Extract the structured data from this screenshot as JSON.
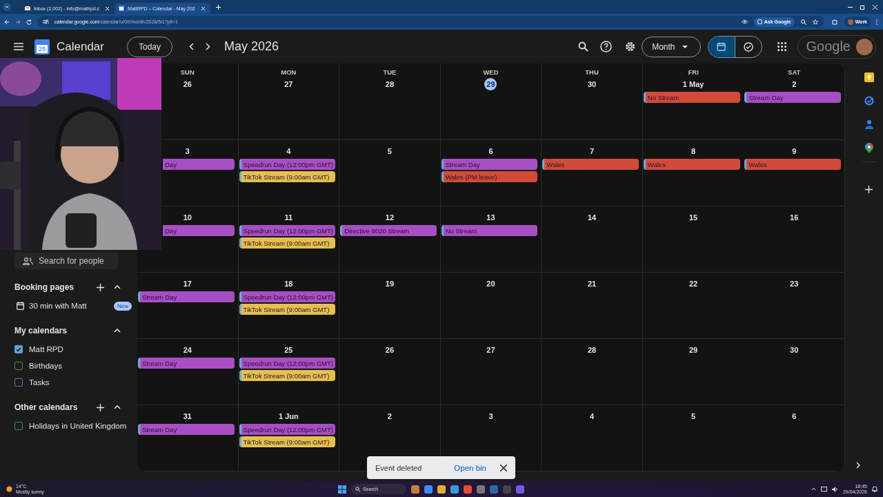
{
  "browser": {
    "tabs": [
      {
        "title": "Inbox (2,002) - info@mattrpd.c",
        "selected": false,
        "kind": "mail"
      },
      {
        "title": "MattRPD – Calendar - May 202",
        "selected": true,
        "kind": "calendar"
      }
    ],
    "url_host": "calendar.google.com",
    "url_path": "/calendar/u/0/r/month/2026/5/1?pli=1",
    "assistant": "Ask Google",
    "profile": "Work"
  },
  "header": {
    "logo_day": "29",
    "title": "Calendar",
    "today_button": "Today",
    "period": "May 2026",
    "view": "Month",
    "brand": "Google"
  },
  "sidebar": {
    "search_placeholder": "Search for people",
    "booking": {
      "title": "Booking pages",
      "items": [
        {
          "label": "30 min with Matt",
          "badge": "New"
        }
      ]
    },
    "my_calendars": {
      "title": "My calendars",
      "items": [
        {
          "label": "Matt RPD",
          "checked": true,
          "color": "#5ea3d9"
        },
        {
          "label": "Birthdays",
          "checked": false,
          "color": "#3c8a4c"
        },
        {
          "label": "Tasks",
          "checked": false,
          "color": "#5d6fbf"
        }
      ]
    },
    "other_calendars": {
      "title": "Other calendars",
      "items": [
        {
          "label": "Holidays in United Kingdom",
          "checked": false,
          "color": "#3c8a4c"
        }
      ]
    }
  },
  "calendar": {
    "weekdays": [
      "SUN",
      "MON",
      "TUE",
      "WED",
      "THU",
      "FRI",
      "SAT"
    ],
    "weeks": [
      [
        {
          "date": "26",
          "today": false
        },
        {
          "date": "27",
          "today": false
        },
        {
          "date": "28",
          "today": false
        },
        {
          "date": "29",
          "today": true
        },
        {
          "date": "30",
          "today": false
        },
        {
          "date": "1 May",
          "today": false,
          "events": [
            {
              "title": "No Stream",
              "color": "#d14b38"
            }
          ]
        },
        {
          "date": "2",
          "today": false,
          "events": [
            {
              "title": "Stream Day",
              "color": "#a84ec4"
            }
          ]
        }
      ],
      [
        {
          "date": "3",
          "today": false,
          "events": [
            {
              "title": "Day",
              "color": "#a84ec4"
            }
          ]
        },
        {
          "date": "4",
          "today": false,
          "events": [
            {
              "title": "Speedrun Day (12:00pm GMT)",
              "color": "#a84ec4"
            },
            {
              "title": "TikTok Stream (9:00am GMT)",
              "color": "#e5c050"
            }
          ]
        },
        {
          "date": "5",
          "today": false
        },
        {
          "date": "6",
          "today": false,
          "events": [
            {
              "title": "Stream Day",
              "color": "#a84ec4"
            },
            {
              "title": "Wales (PM leave)",
              "color": "#d14b38"
            }
          ]
        },
        {
          "date": "7",
          "today": false,
          "events": [
            {
              "title": "Wales",
              "color": "#d14b38"
            }
          ]
        },
        {
          "date": "8",
          "today": false,
          "events": [
            {
              "title": "Wales",
              "color": "#d14b38"
            }
          ]
        },
        {
          "date": "9",
          "today": false,
          "events": [
            {
              "title": "Wales",
              "color": "#d14b38"
            }
          ]
        }
      ],
      [
        {
          "date": "10",
          "today": false,
          "events": [
            {
              "title": "Day",
              "color": "#a84ec4"
            }
          ]
        },
        {
          "date": "11",
          "today": false,
          "events": [
            {
              "title": "Speedrun Day (12:00pm GMT)",
              "color": "#a84ec4"
            },
            {
              "title": "TikTok Stream (9:00am GMT)",
              "color": "#e5c050"
            }
          ]
        },
        {
          "date": "12",
          "today": false,
          "events": [
            {
              "title": "Directive 8020 Stream",
              "color": "#a84ec4"
            }
          ]
        },
        {
          "date": "13",
          "today": false,
          "events": [
            {
              "title": "No Stream",
              "color": "#a84ec4"
            }
          ]
        },
        {
          "date": "14",
          "today": false
        },
        {
          "date": "15",
          "today": false
        },
        {
          "date": "16",
          "today": false
        }
      ],
      [
        {
          "date": "17",
          "today": false,
          "events": [
            {
              "title": "Stream Day",
              "color": "#a84ec4"
            }
          ]
        },
        {
          "date": "18",
          "today": false,
          "events": [
            {
              "title": "Speedrun Day (12:00pm GMT)",
              "color": "#a84ec4"
            },
            {
              "title": "TikTok Stream (9:00am GMT)",
              "color": "#e5c050"
            }
          ]
        },
        {
          "date": "19",
          "today": false
        },
        {
          "date": "20",
          "today": false
        },
        {
          "date": "21",
          "today": false
        },
        {
          "date": "22",
          "today": false
        },
        {
          "date": "23",
          "today": false
        }
      ],
      [
        {
          "date": "24",
          "today": false,
          "events": [
            {
              "title": "Stream Day",
              "color": "#a84ec4"
            }
          ]
        },
        {
          "date": "25",
          "today": false,
          "events": [
            {
              "title": "Speedrun Day (12:00pm GMT)",
              "color": "#a84ec4"
            },
            {
              "title": "TikTok Stream (9:00am GMT)",
              "color": "#e5c050"
            }
          ]
        },
        {
          "date": "26",
          "today": false
        },
        {
          "date": "27",
          "today": false
        },
        {
          "date": "28",
          "today": false
        },
        {
          "date": "29",
          "today": false
        },
        {
          "date": "30",
          "today": false
        }
      ],
      [
        {
          "date": "31",
          "today": false,
          "events": [
            {
              "title": "Stream Day",
              "color": "#a84ec4"
            }
          ]
        },
        {
          "date": "1 Jun",
          "today": false,
          "events": [
            {
              "title": "Speedrun Day (12:00pm GMT)",
              "color": "#a84ec4"
            },
            {
              "title": "TikTok Stream (9:00am GMT)",
              "color": "#e5c050"
            }
          ]
        },
        {
          "date": "2",
          "today": false
        },
        {
          "date": "3",
          "today": false
        },
        {
          "date": "4",
          "today": false
        },
        {
          "date": "5",
          "today": false
        },
        {
          "date": "6",
          "today": false
        }
      ]
    ]
  },
  "toast": {
    "message": "Event deleted",
    "action": "Open bin"
  },
  "taskbar": {
    "temperature": "14°C",
    "weather": "Mostly sunny",
    "search": "Search",
    "time": "18:45",
    "date": "29/04/2026"
  }
}
